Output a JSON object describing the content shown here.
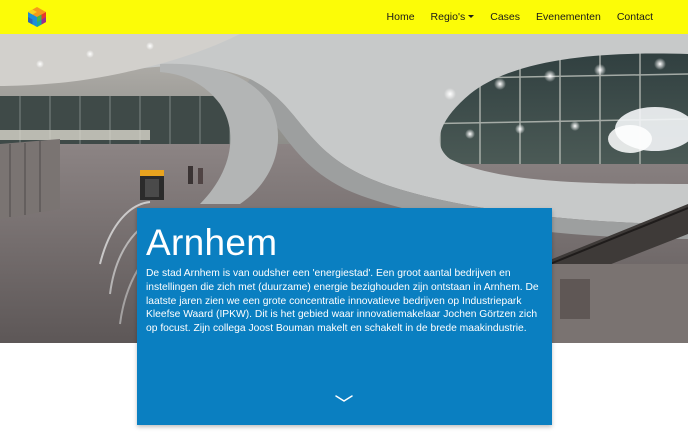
{
  "nav": {
    "logo_icon": "cube-logo-icon",
    "items": [
      {
        "label": "Home"
      },
      {
        "label": "Regio's",
        "has_dropdown": true
      },
      {
        "label": "Cases"
      },
      {
        "label": "Evenementen"
      },
      {
        "label": "Contact"
      }
    ]
  },
  "hero": {
    "image_icon": "arnhem-station-photo"
  },
  "card": {
    "title": "Arnhem",
    "text": "De stad Arnhem is van oudsher een 'energiestad'. Een groot aantal bedrijven en instellingen die zich met (duurzame) energie bezighouden zijn ontstaan in Arnhem. De laatste jaren zien we een grote concentratie innovatieve bedrijven op Industriepark Kleefse Waard (IPKW). Dit is het gebied waar innovatiemakelaar Jochen Görtzen zich op focust. Zijn collega Joost Bouman makelt en schakelt in de brede maakindustrie.",
    "scroll_icon": "chevron-down-icon"
  },
  "colors": {
    "navbar_bg": "#fcfc07",
    "card_bg": "#0a7fc1",
    "text_on_card": "#ffffff"
  }
}
